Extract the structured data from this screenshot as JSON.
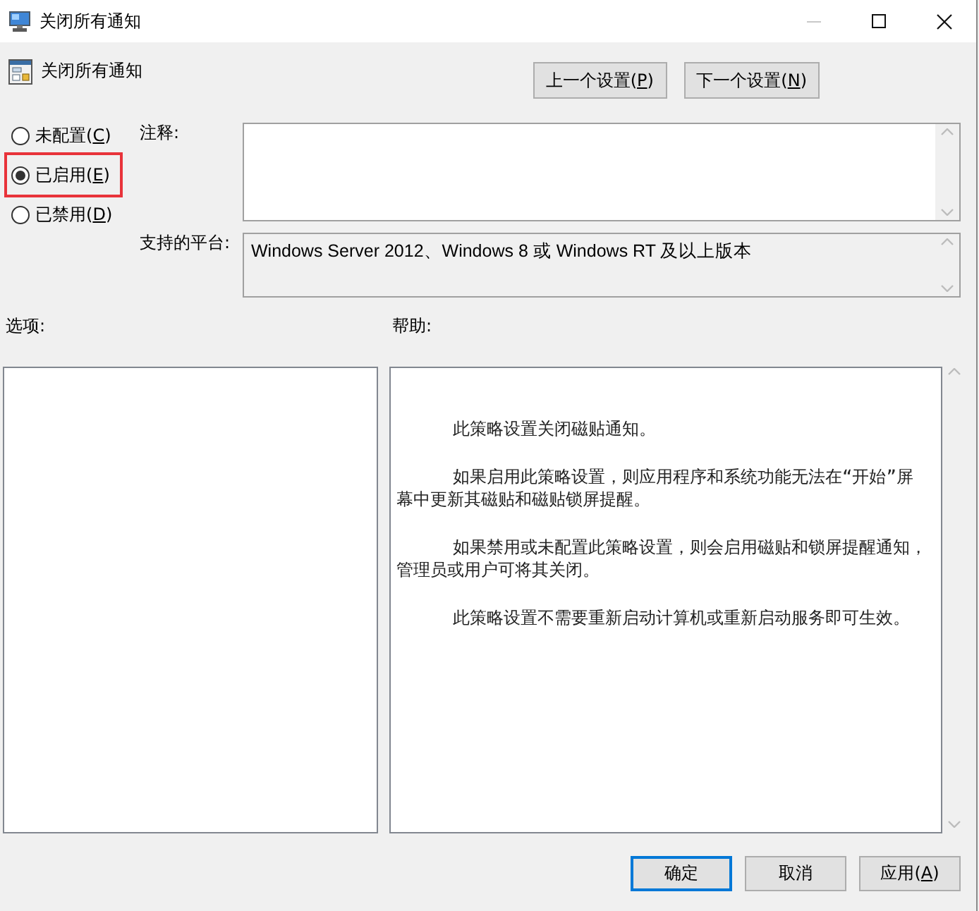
{
  "window": {
    "title": "关闭所有通知",
    "controls": [
      {
        "kind": "minimize",
        "disabled": true
      },
      {
        "kind": "maximize",
        "disabled": false
      },
      {
        "kind": "close",
        "disabled": false
      }
    ]
  },
  "header": {
    "title": "关闭所有通知",
    "nav_buttons": [
      {
        "label": "上一个设置(",
        "mnemonic": "P",
        "label_end": ")"
      },
      {
        "label": "下一个设置(",
        "mnemonic": "N",
        "label_end": ")"
      }
    ]
  },
  "policy_states": [
    {
      "label": "未配置(",
      "mnemonic": "C",
      "label_end": ")",
      "selected": false,
      "highlighted": false
    },
    {
      "label": "已启用(",
      "mnemonic": "E",
      "label_end": ")",
      "selected": true,
      "highlighted": true
    },
    {
      "label": "已禁用(",
      "mnemonic": "D",
      "label_end": ")",
      "selected": false,
      "highlighted": false
    }
  ],
  "comment": {
    "label": "注释:"
  },
  "supported_on": {
    "label": "支持的平台:",
    "value": "Windows Server 2012、Windows 8 或 Windows RT 及以上版本"
  },
  "options": {
    "label": "选项:"
  },
  "help": {
    "label": "帮助:",
    "paragraphs": [
      "此策略设置关闭磁贴通知。",
      "如果启用此策略设置，则应用程序和系统功能无法在“开始”屏幕中更新其磁贴和磁贴锁屏提醒。",
      "如果禁用或未配置此策略设置，则会启用磁贴和锁屏提醒通知，管理员或用户可将其关闭。",
      "此策略设置不需要重新启动计算机或重新启动服务即可生效。"
    ]
  },
  "footer_buttons": [
    {
      "label": "确定",
      "focused": true
    },
    {
      "label": "取消",
      "focused": false
    },
    {
      "label": "应用(",
      "mnemonic": "A",
      "label_end": ")",
      "focused": false
    }
  ]
}
